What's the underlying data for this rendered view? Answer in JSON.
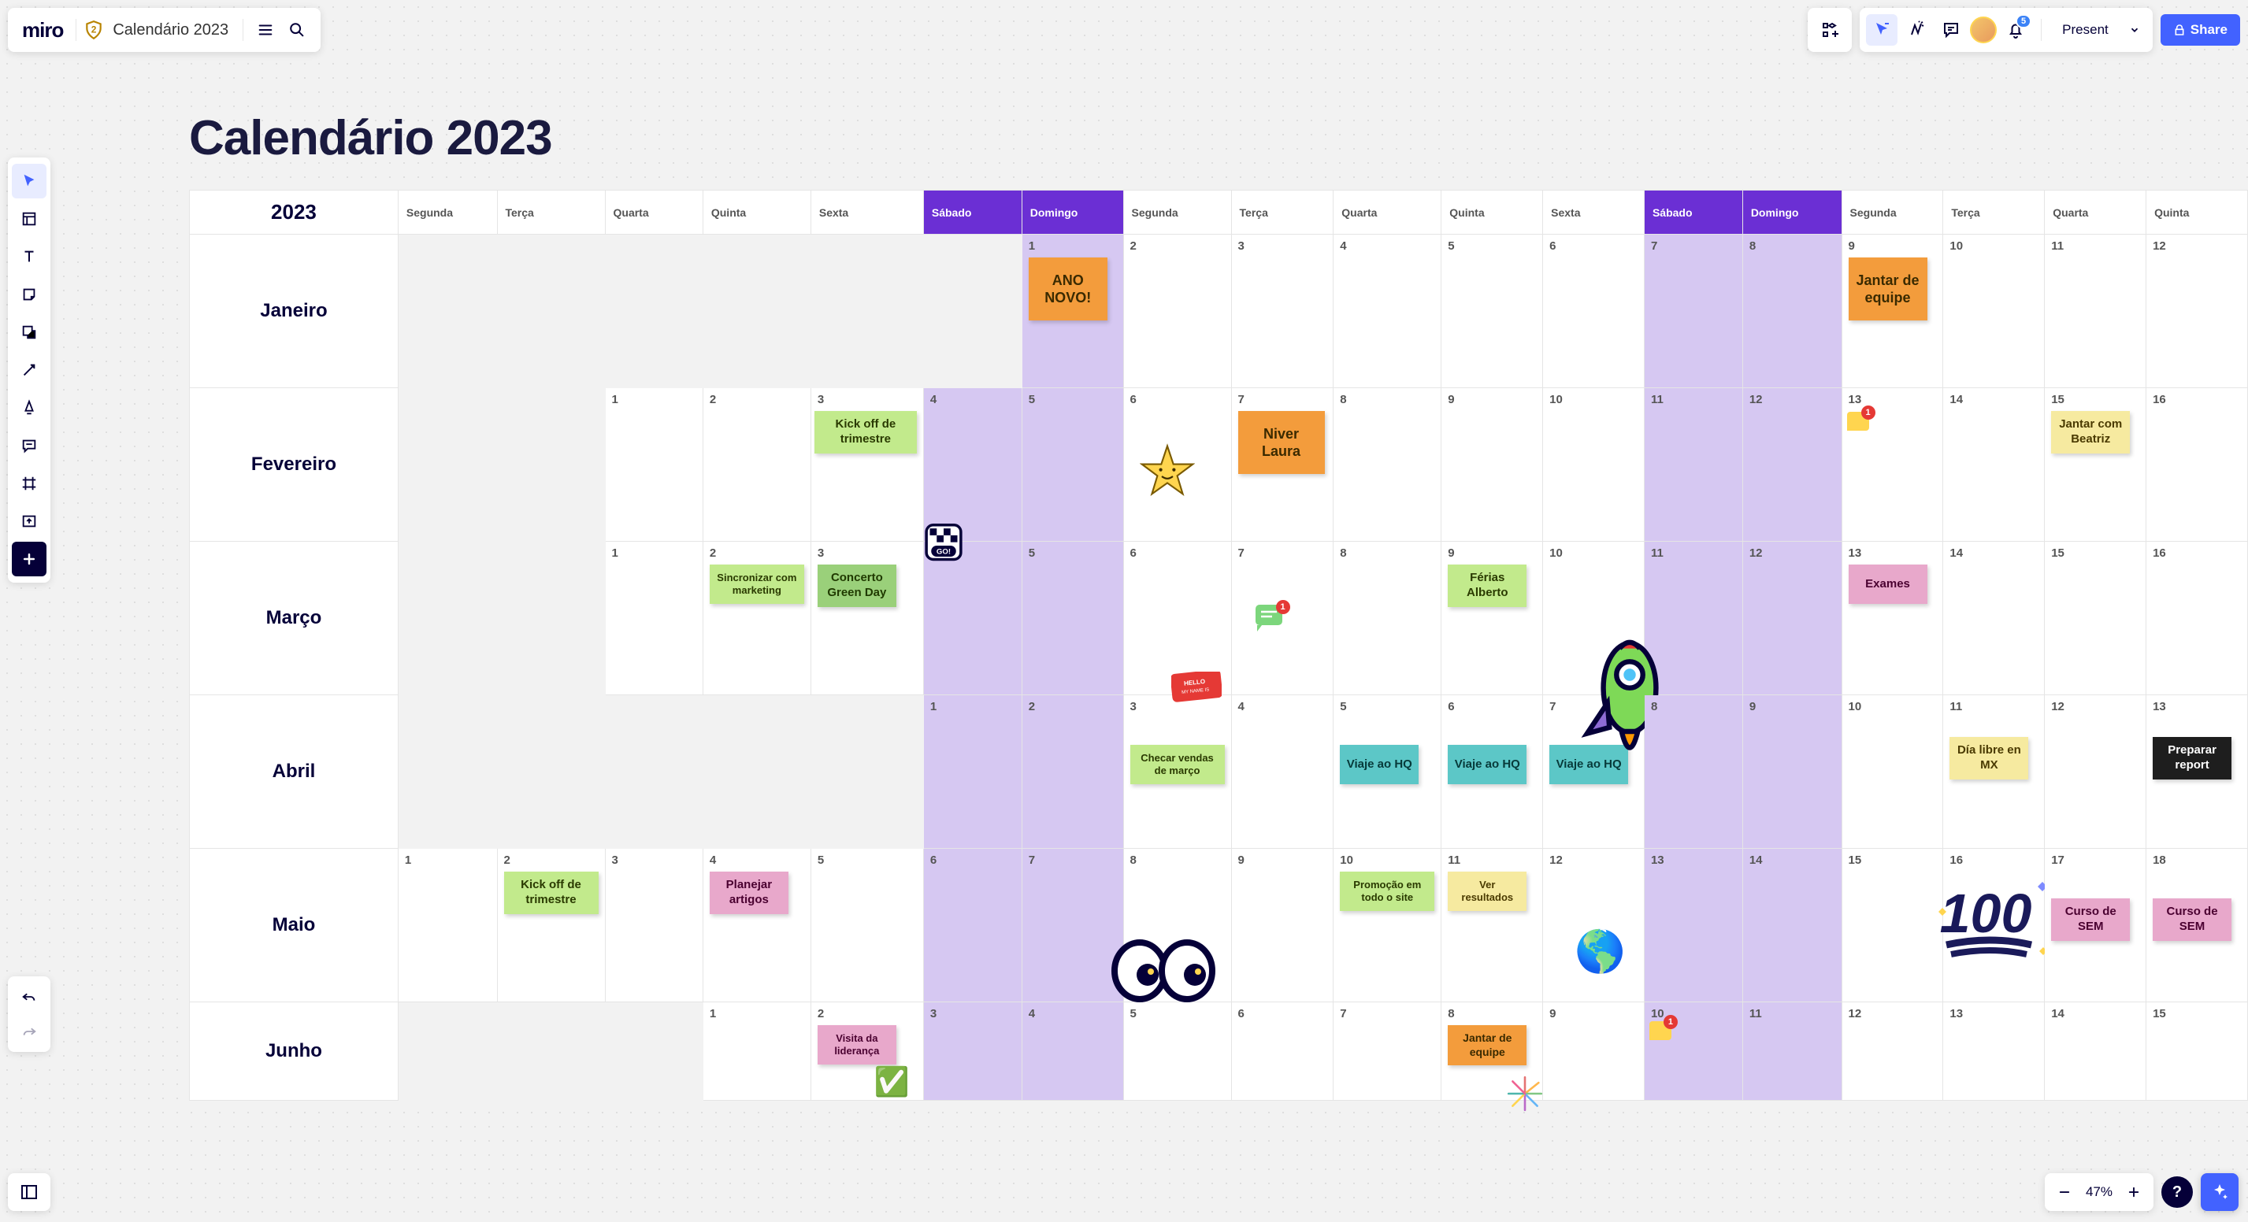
{
  "header": {
    "logo_text": "miro",
    "shield_badge": "2",
    "board_title": "Calendário 2023",
    "present_label": "Present",
    "share_label": "Share",
    "notification_count": "5"
  },
  "canvas": {
    "title": "Calendário 2023",
    "year_label": "2023"
  },
  "days": {
    "segunda": "Segunda",
    "terca": "Terça",
    "quarta": "Quarta",
    "quinta": "Quinta",
    "sexta": "Sexta",
    "sabado": "Sábado",
    "domingo": "Domingo"
  },
  "months": {
    "janeiro": "Janeiro",
    "fevereiro": "Fevereiro",
    "marco": "Março",
    "abril": "Abril",
    "maio": "Maio",
    "junho": "Junho"
  },
  "stickies": {
    "ano_novo": "ANO NOVO!",
    "jantar_equipe": "Jantar de equipe",
    "kickoff": "Kick off de trimestre",
    "niver_laura": "Niver Laura",
    "jantar_beatriz": "Jantar com Beatriz",
    "sincronizar_mkt": "Sincronizar com marketing",
    "concerto_gd": "Concerto Green Day",
    "ferias_alberto": "Férias Alberto",
    "exames": "Exames",
    "checar_vendas": "Checar vendas de março",
    "viaje_hq": "Viaje ao HQ",
    "dia_libre_mx": "Día libre en MX",
    "preparar_report": "Preparar report",
    "planejar_artigos": "Planejar artigos",
    "promocao_site": "Promoção em todo o site",
    "ver_resultados": "Ver resultados",
    "curso_sem": "Curso de SEM",
    "visita_lideranca": "Visita da liderança"
  },
  "comment_badges": {
    "c1": "1",
    "c2": "1",
    "c3": "1"
  },
  "zoom": {
    "value": "47%"
  },
  "help": {
    "label": "?"
  }
}
